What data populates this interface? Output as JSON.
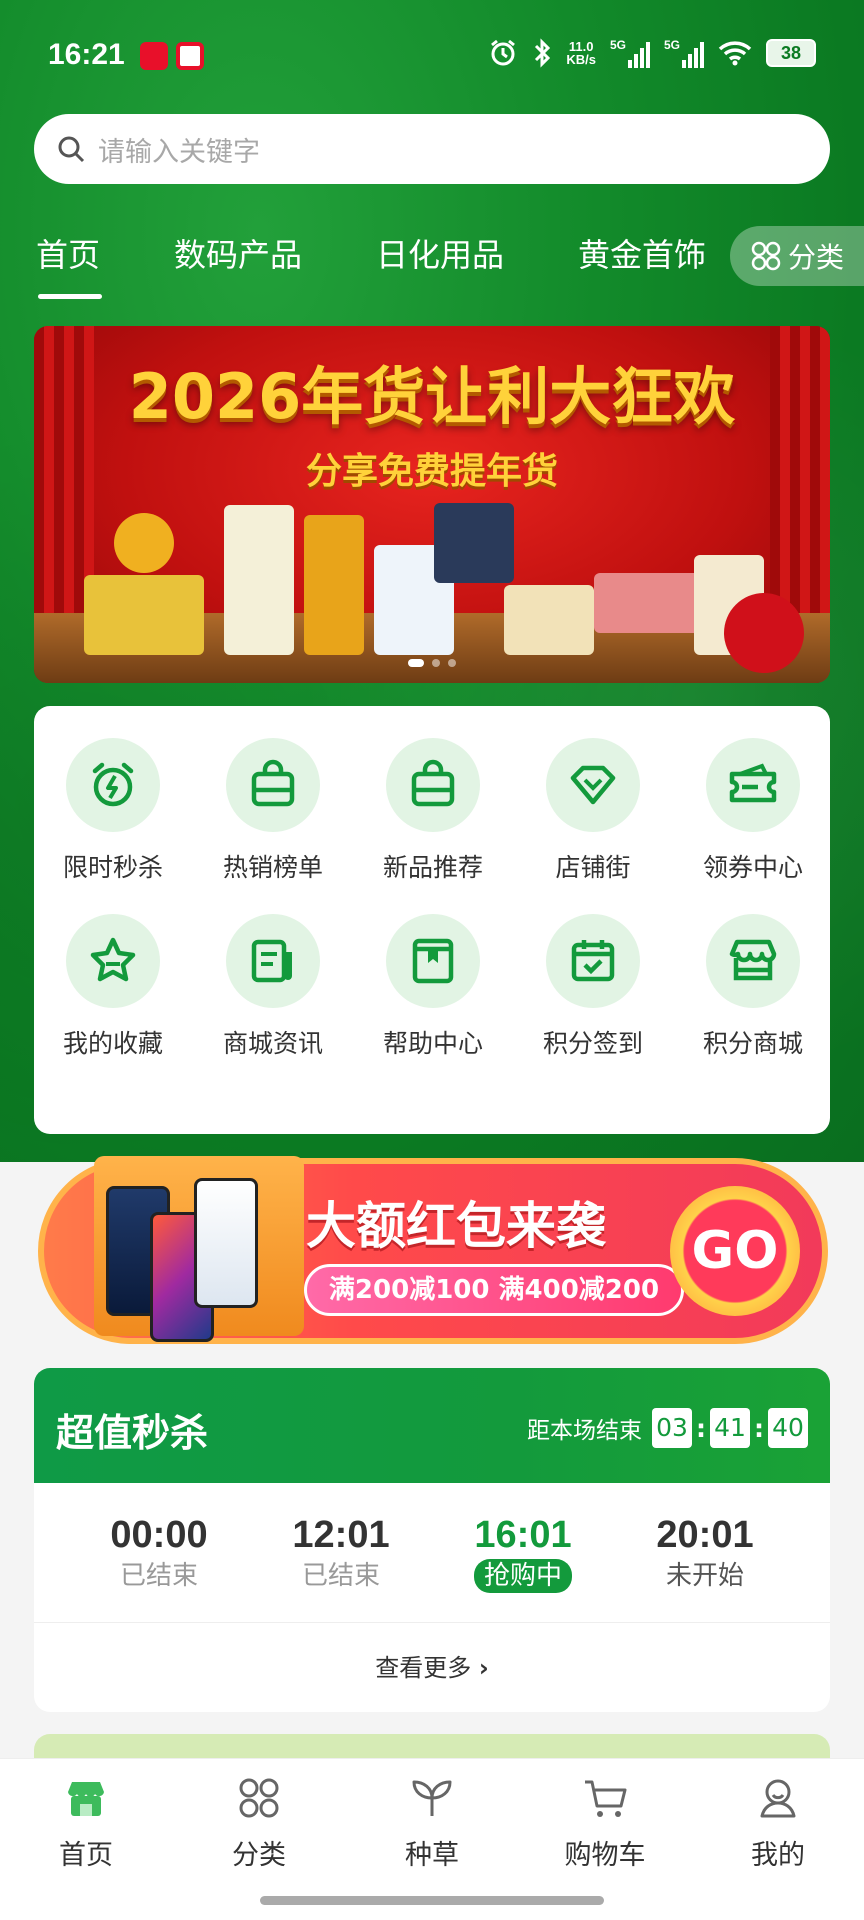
{
  "status_bar": {
    "time": "16:21",
    "net_speed_value": "11.0",
    "net_speed_unit": "KB/s",
    "signal_1": "5G",
    "signal_2": "5G",
    "battery": "38"
  },
  "search": {
    "placeholder": "请输入关键字"
  },
  "tabs": [
    {
      "label": "首页",
      "active": true
    },
    {
      "label": "数码产品"
    },
    {
      "label": "日化用品"
    },
    {
      "label": "黄金首饰"
    }
  ],
  "category_button": {
    "label": "分类"
  },
  "banner": {
    "title": "2026年货让利大狂欢",
    "subtitle": "分享免费提年货"
  },
  "quick_grid": [
    {
      "label": "限时秒杀",
      "icon": "alarm-clock-icon"
    },
    {
      "label": "热销榜单",
      "icon": "shopping-bag-icon"
    },
    {
      "label": "新品推荐",
      "icon": "shopping-bag-icon"
    },
    {
      "label": "店铺街",
      "icon": "diamond-icon"
    },
    {
      "label": "领券中心",
      "icon": "coupon-icon"
    },
    {
      "label": "我的收藏",
      "icon": "star-icon"
    },
    {
      "label": "商城资讯",
      "icon": "news-icon"
    },
    {
      "label": "帮助中心",
      "icon": "book-icon"
    },
    {
      "label": "积分签到",
      "icon": "calendar-check-icon"
    },
    {
      "label": "积分商城",
      "icon": "store-icon"
    }
  ],
  "promo": {
    "headline": "大额红包来袭",
    "offer": "满200减100 满400减200",
    "go": "GO"
  },
  "flash_sale": {
    "title": "超值秒杀",
    "ends_label": "距本场结束",
    "countdown": [
      "03",
      "41",
      "40"
    ],
    "slots": [
      {
        "time": "00:00",
        "status": "已结束"
      },
      {
        "time": "12:01",
        "status": "已结束"
      },
      {
        "time": "16:01",
        "status": "抢购中"
      },
      {
        "time": "20:01",
        "status": "未开始"
      }
    ],
    "more": "查看更多"
  },
  "bottom_nav": [
    {
      "label": "首页",
      "icon": "home-store-icon",
      "active": true
    },
    {
      "label": "分类",
      "icon": "grid-icon"
    },
    {
      "label": "种草",
      "icon": "sprout-icon"
    },
    {
      "label": "购物车",
      "icon": "cart-icon"
    },
    {
      "label": "我的",
      "icon": "user-icon"
    }
  ],
  "colors": {
    "brand_green": "#139a3c",
    "icon_circle": "#e2f4e4"
  }
}
